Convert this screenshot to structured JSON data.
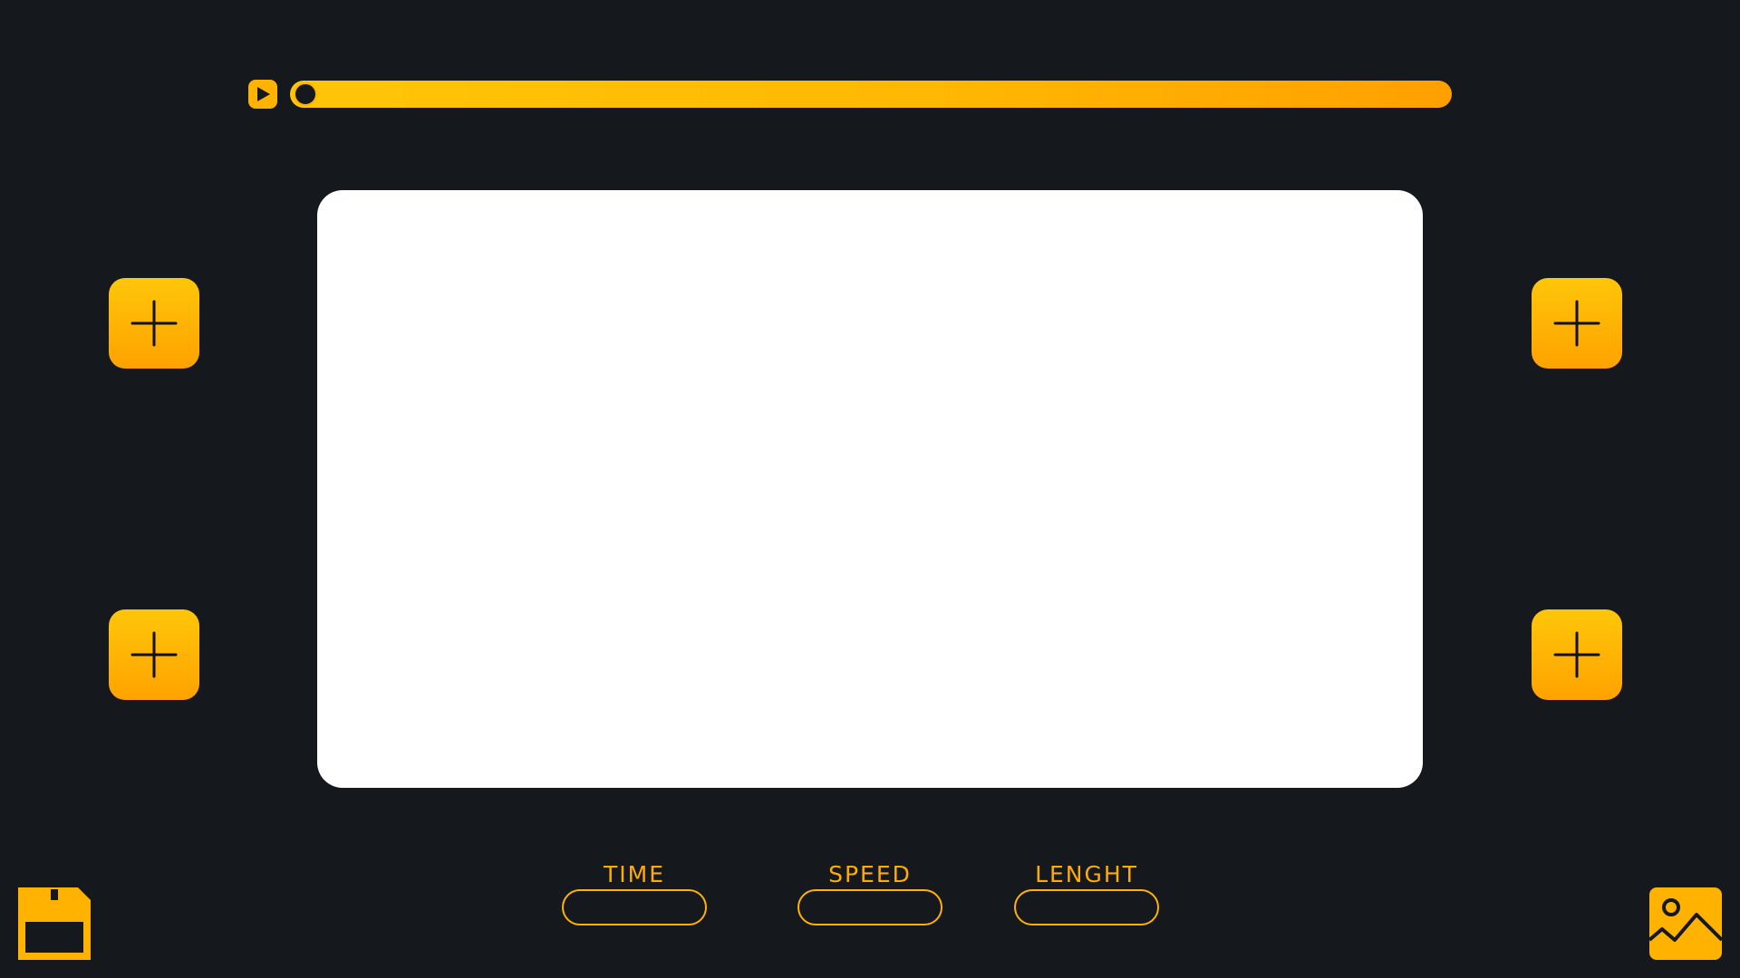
{
  "player": {
    "play_icon": "play-icon",
    "progress_value": 0.0
  },
  "actions": {
    "add_icon": "plus-icon",
    "save_icon": "floppy-disk-icon",
    "image_icon": "image-icon"
  },
  "fields": {
    "time_label": "TIME",
    "speed_label": "SPEED",
    "length_label": "LENGHT",
    "time_value": "",
    "speed_value": "",
    "length_value": ""
  },
  "colors": {
    "background": "#15181d",
    "accent": "#ffb300",
    "canvas": "#ffffff"
  }
}
